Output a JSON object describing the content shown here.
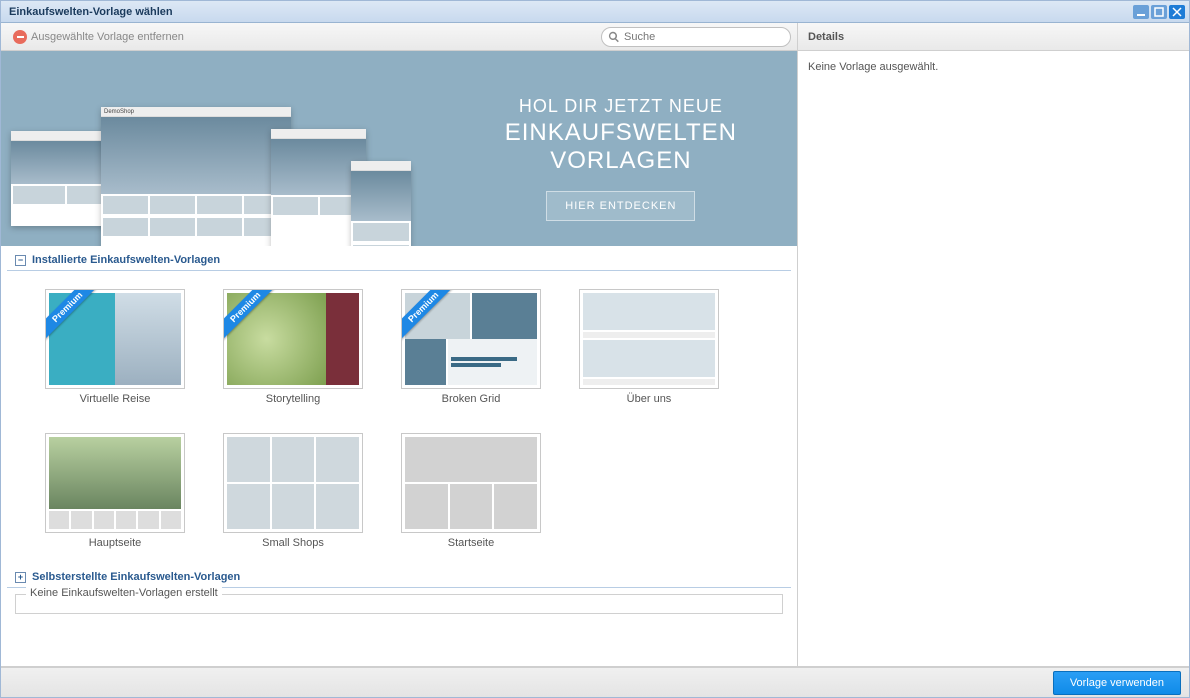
{
  "window": {
    "title": "Einkaufswelten-Vorlage wählen"
  },
  "toolbar": {
    "remove_label": "Ausgewählte Vorlage entfernen",
    "search_placeholder": "Suche"
  },
  "banner": {
    "line1": "HOL DIR JETZT NEUE",
    "line2": "EINKAUFSWELTEN",
    "line3": "VORLAGEN",
    "cta": "HIER ENTDECKEN",
    "brand": "DemoShop"
  },
  "sections": {
    "installed": "Installierte Einkaufswelten-Vorlagen",
    "custom": "Selbsterstellte Einkaufswelten-Vorlagen"
  },
  "templates": [
    {
      "label": "Virtuelle Reise",
      "premium": true
    },
    {
      "label": "Storytelling",
      "premium": true
    },
    {
      "label": "Broken Grid",
      "premium": true
    },
    {
      "label": "Über uns",
      "premium": false
    },
    {
      "label": "Hauptseite",
      "premium": false
    },
    {
      "label": "Small Shops",
      "premium": false
    },
    {
      "label": "Startseite",
      "premium": false
    }
  ],
  "premium_ribbon": "Premium",
  "empty_custom": "Keine Einkaufswelten-Vorlagen erstellt",
  "details": {
    "title": "Details",
    "empty": "Keine Vorlage ausgewählt."
  },
  "footer": {
    "apply": "Vorlage verwenden"
  }
}
